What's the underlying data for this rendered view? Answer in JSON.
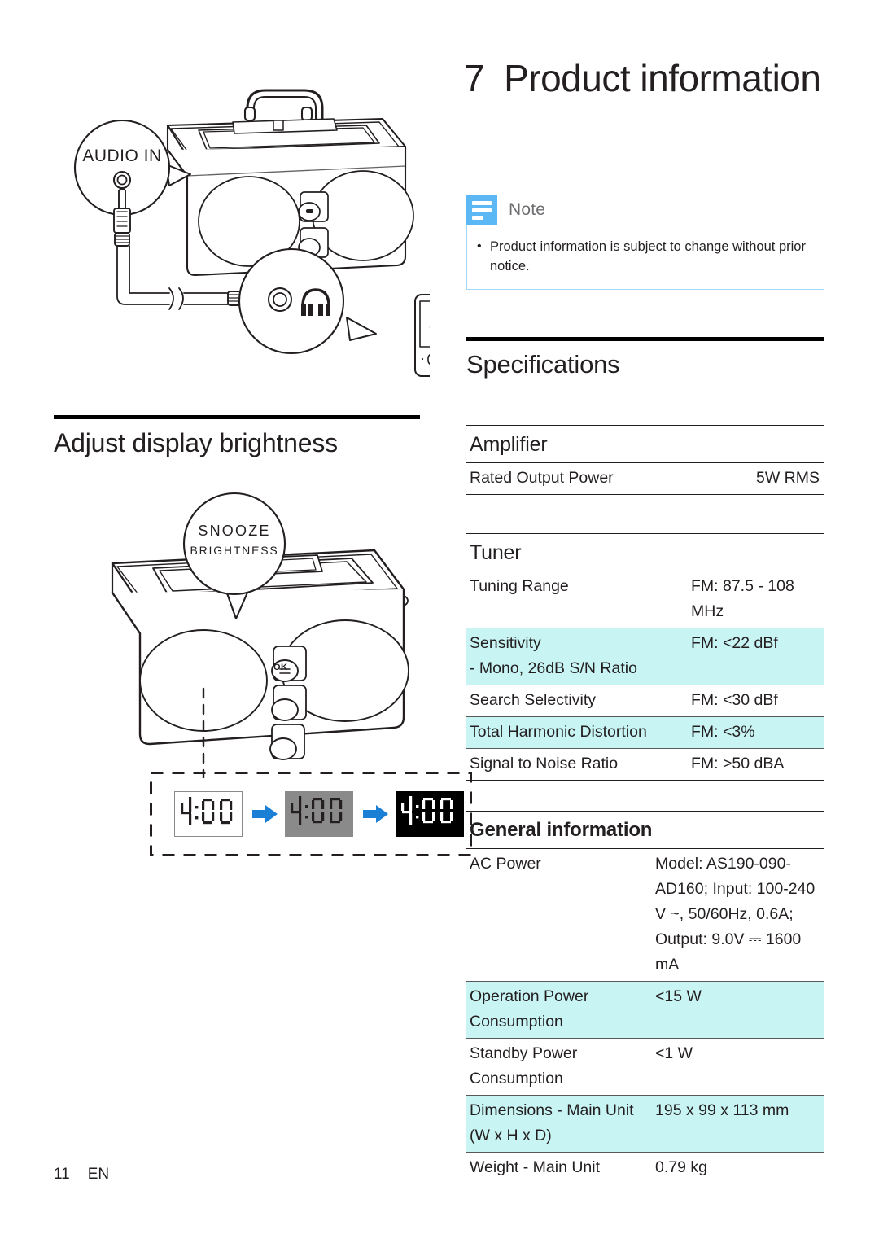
{
  "chapter": {
    "number": "7",
    "title": "Product information"
  },
  "note": {
    "label": "Note",
    "icon": "note-lines-icon",
    "bullet": "•",
    "text": "Product information is subject to change without prior notice.",
    "accent_color": "#5bb8f5",
    "border_color": "#9fd8f7"
  },
  "sections": {
    "specifications_heading": "Specifications",
    "brightness_heading": "Adjust display brightness"
  },
  "highlight_color": "#c9f4f4",
  "tables": [
    {
      "title": "Amplifier",
      "bold_title": false,
      "rows": [
        {
          "key": "Rated Output Power",
          "value": "5W RMS",
          "highlight": false
        }
      ]
    },
    {
      "title": "Tuner",
      "bold_title": false,
      "rows": [
        {
          "key": "Tuning Range",
          "value": "FM: 87.5 - 108 MHz",
          "highlight": false
        },
        {
          "key": "Sensitivity\n - Mono, 26dB S/N Ratio",
          "value": "FM: <22 dBf",
          "highlight": true
        },
        {
          "key": "Search Selectivity",
          "value": "FM: <30 dBf",
          "highlight": false
        },
        {
          "key": "Total Harmonic Distortion",
          "value": "FM: <3%",
          "highlight": true
        },
        {
          "key": "Signal to Noise Ratio",
          "value": "FM: >50 dBA",
          "highlight": false
        }
      ]
    },
    {
      "title": "General information",
      "bold_title": true,
      "rows": [
        {
          "key": "AC Power",
          "value": "Model: AS190-090-AD160; Input: 100-240 V ~, 50/60Hz, 0.6A; Output: 9.0V ⎓ 1600 mA",
          "highlight": false
        },
        {
          "key": "Operation Power Consumption",
          "value": "<15 W",
          "highlight": true
        },
        {
          "key": "Standby Power Consumption",
          "value": "<1 W",
          "highlight": false
        },
        {
          "key": "Dimensions - Main Unit (W x H x D)",
          "value": "195 x 99 x 113 mm",
          "highlight": true
        },
        {
          "key": "Weight - Main Unit",
          "value": "0.79 kg",
          "highlight": false
        }
      ]
    }
  ],
  "illustrations": {
    "audio_in_callout": "AUDIO IN",
    "snooze_callout_line1": "SNOOZE",
    "snooze_callout_line2": "BRIGHTNESS",
    "ok_button_label": "OK",
    "display_value": "4:00",
    "brightness_steps": [
      {
        "mode": "bright",
        "background": "#ffffff",
        "digit_color": "#231f20"
      },
      {
        "mode": "dim",
        "background": "#8a8a8a",
        "digit_color": "#231f20"
      },
      {
        "mode": "off",
        "background": "#000000",
        "digit_color": "#ffffff"
      }
    ],
    "arrow_color": "#1c7fd6"
  },
  "footer": {
    "page_number": "11",
    "language": "EN"
  }
}
